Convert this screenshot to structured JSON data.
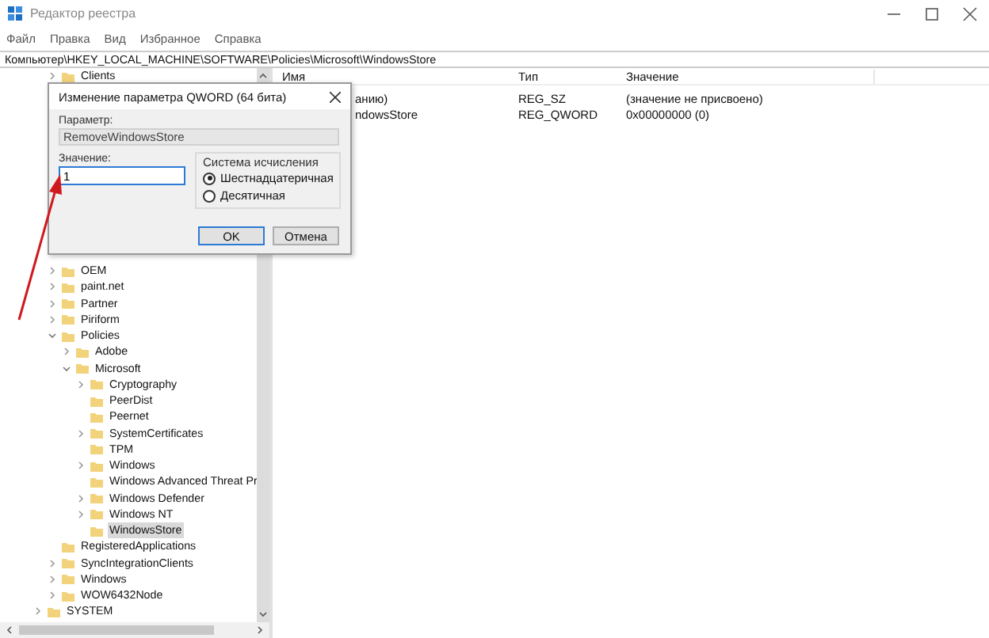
{
  "window": {
    "title": "Редактор реестра"
  },
  "menu": [
    "Файл",
    "Правка",
    "Вид",
    "Избранное",
    "Справка"
  ],
  "address": "Компьютер\\HKEY_LOCAL_MACHINE\\SOFTWARE\\Policies\\Microsoft\\WindowsStore",
  "tree": [
    {
      "children": [
        {
          "label": "Clients",
          "has_children": true,
          "expanded": false,
          "selected": false
        },
        {
          "label": "OEM",
          "has_children": true,
          "expanded": false,
          "selected": false
        },
        {
          "label": "paint.net",
          "has_children": true,
          "expanded": false,
          "selected": false
        },
        {
          "label": "Partner",
          "has_children": true,
          "expanded": false,
          "selected": false
        },
        {
          "label": "Piriform",
          "has_children": true,
          "expanded": false,
          "selected": false
        },
        {
          "label": "Policies",
          "has_children": true,
          "expanded": true,
          "selected": false,
          "children": [
            {
              "label": "Adobe",
              "has_children": true,
              "expanded": false,
              "selected": false
            },
            {
              "label": "Microsoft",
              "has_children": true,
              "expanded": true,
              "selected": false,
              "children": [
                {
                  "label": "Cryptography",
                  "has_children": true,
                  "expanded": false,
                  "selected": false
                },
                {
                  "label": "PeerDist",
                  "has_children": false,
                  "selected": false
                },
                {
                  "label": "Peernet",
                  "has_children": false,
                  "selected": false
                },
                {
                  "label": "SystemCertificates",
                  "has_children": true,
                  "expanded": false,
                  "selected": false
                },
                {
                  "label": "TPM",
                  "has_children": false,
                  "selected": false
                },
                {
                  "label": "Windows",
                  "has_children": true,
                  "expanded": false,
                  "selected": false
                },
                {
                  "label": "Windows Advanced Threat Pr",
                  "has_children": false,
                  "selected": false
                },
                {
                  "label": "Windows Defender",
                  "has_children": true,
                  "expanded": false,
                  "selected": false
                },
                {
                  "label": "Windows NT",
                  "has_children": true,
                  "expanded": false,
                  "selected": false
                },
                {
                  "label": "WindowsStore",
                  "has_children": false,
                  "selected": true
                }
              ]
            }
          ]
        },
        {
          "label": "RegisteredApplications",
          "has_children": false,
          "selected": false
        },
        {
          "label": "SyncIntegrationClients",
          "has_children": true,
          "expanded": false,
          "selected": false
        },
        {
          "label": "Windows",
          "has_children": true,
          "expanded": false,
          "selected": false
        },
        {
          "label": "WOW6432Node",
          "has_children": true,
          "expanded": false,
          "selected": false
        }
      ]
    },
    {
      "label": "SYSTEM",
      "has_children": true,
      "expanded": false,
      "selected": false
    }
  ],
  "list": {
    "columns": [
      "Имя",
      "Тип",
      "Значение"
    ],
    "rows": [
      {
        "name": "анию)",
        "type": "REG_SZ",
        "data": "(значение не присвоено)"
      },
      {
        "name": "ndowsStore",
        "type": "REG_QWORD",
        "data": "0x00000000 (0)"
      }
    ]
  },
  "dialog": {
    "title": "Изменение параметра QWORD (64 бита)",
    "name_label": "Параметр:",
    "name_value": "RemoveWindowsStore",
    "value_label": "Значение:",
    "value": "1",
    "base_group": "Система исчисления",
    "base_options": [
      {
        "label": "Шестнадцатеричная",
        "selected": true
      },
      {
        "label": "Десятичная",
        "selected": false
      }
    ],
    "buttons": [
      {
        "label": "OK",
        "default": true
      },
      {
        "label": "Отмена",
        "default": false
      }
    ]
  }
}
